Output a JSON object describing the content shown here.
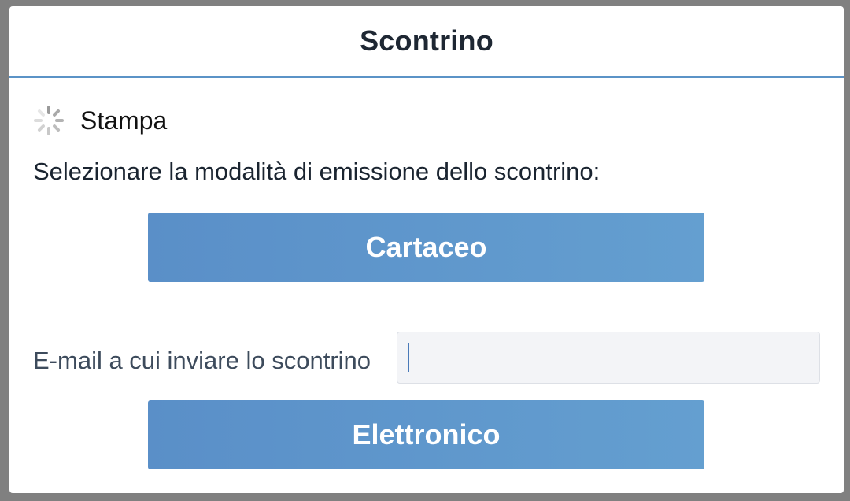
{
  "dialog": {
    "title": "Scontrino"
  },
  "status": {
    "label": "Stampa",
    "icon": "spinner-icon"
  },
  "prompt": "Selezionare la modalità di emissione dello scontrino:",
  "buttons": {
    "paper_label": "Cartaceo",
    "electronic_label": "Elettronico"
  },
  "email": {
    "label": "E-mail a cui inviare lo scontrino",
    "value": "",
    "placeholder": ""
  },
  "colors": {
    "accent": "#5b93c7",
    "button_start": "#5a8fc8",
    "button_end": "#649fd0",
    "title_text": "#1e2733"
  }
}
